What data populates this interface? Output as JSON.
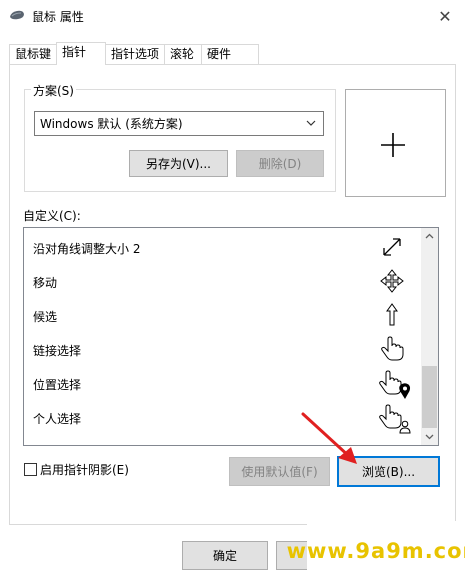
{
  "window": {
    "title": "鼠标 属性",
    "close_glyph": "✕"
  },
  "tabs": [
    {
      "label": "鼠标键",
      "active": false
    },
    {
      "label": "指针",
      "active": true
    },
    {
      "label": "指针选项",
      "active": false
    },
    {
      "label": "滚轮",
      "active": false
    },
    {
      "label": "硬件",
      "active": false
    }
  ],
  "scheme": {
    "label": "方案(S)",
    "selected": "Windows 默认 (系统方案)",
    "save_as_label": "另存为(V)...",
    "delete_label": "删除(D)"
  },
  "customize": {
    "label": "自定义(C):",
    "items": [
      {
        "label": "沿对角线调整大小 2",
        "icon": "diagonal-resize-2-icon"
      },
      {
        "label": "移动",
        "icon": "move-icon"
      },
      {
        "label": "候选",
        "icon": "alternate-select-icon"
      },
      {
        "label": "链接选择",
        "icon": "link-select-icon"
      },
      {
        "label": "位置选择",
        "icon": "location-select-icon"
      },
      {
        "label": "个人选择",
        "icon": "person-select-icon"
      }
    ]
  },
  "shadow_checkbox": {
    "label": "启用指针阴影(E)",
    "checked": false
  },
  "use_default_label": "使用默认值(F)",
  "browse_label": "浏览(B)...",
  "footer": {
    "ok_label": "确定"
  },
  "watermark": "www.9a9m.com",
  "colors": {
    "arrow": "#e02020",
    "watermark": "#e8c300",
    "focus_border": "#0078d7"
  }
}
